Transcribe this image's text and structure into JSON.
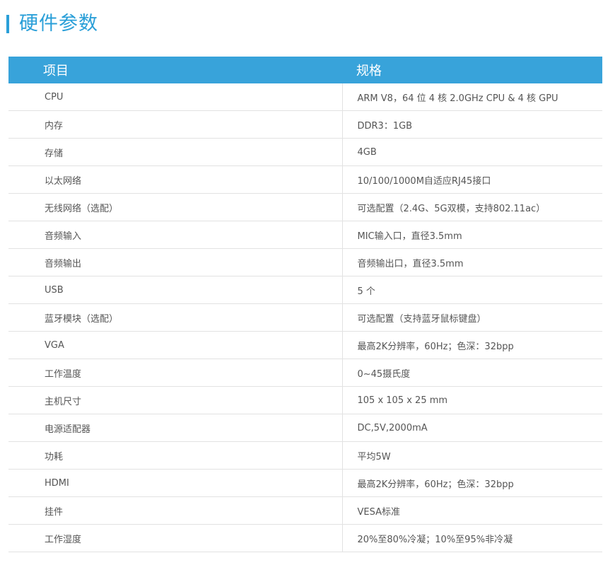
{
  "section": {
    "title": "硬件参数"
  },
  "table": {
    "header": {
      "item": "项目",
      "spec": "规格"
    },
    "rows": [
      {
        "item": "CPU",
        "spec": "ARM V8，64 位 4 核 2.0GHz CPU & 4 核 GPU"
      },
      {
        "item": "内存",
        "spec": "DDR3：1GB"
      },
      {
        "item": "存储",
        "spec": "4GB"
      },
      {
        "item": "以太网络",
        "spec": "10/100/1000M自适应RJ45接口"
      },
      {
        "item": "无线网络（选配）",
        "spec": "可选配置（2.4G、5G双模，支持802.11ac）"
      },
      {
        "item": "音频输入",
        "spec": "MIC输入口，直径3.5mm"
      },
      {
        "item": "音频输出",
        "spec": "音频输出口，直径3.5mm"
      },
      {
        "item": "USB",
        "spec": "5 个"
      },
      {
        "item": "蓝牙模块（选配）",
        "spec": "可选配置（支持蓝牙鼠标键盘）"
      },
      {
        "item": "VGA",
        "spec": "最高2K分辨率，60Hz；色深：32bpp"
      },
      {
        "item": "工作温度",
        "spec": "0~45摄氏度"
      },
      {
        "item": "主机尺寸",
        "spec": "105 x 105 x 25 mm"
      },
      {
        "item": "电源适配器",
        "spec": "DC,5V,2000mA"
      },
      {
        "item": "功耗",
        "spec": "平均5W"
      },
      {
        "item": "HDMI",
        "spec": "最高2K分辨率，60Hz；色深：32bpp"
      },
      {
        "item": "挂件",
        "spec": "VESA标准"
      },
      {
        "item": "工作湿度",
        "spec": "20%至80%冷凝；10%至95%非冷凝"
      }
    ]
  },
  "colors": {
    "accent": "#2a9fd8",
    "header_bg": "#38a3da",
    "border": "#e2e2e2"
  }
}
